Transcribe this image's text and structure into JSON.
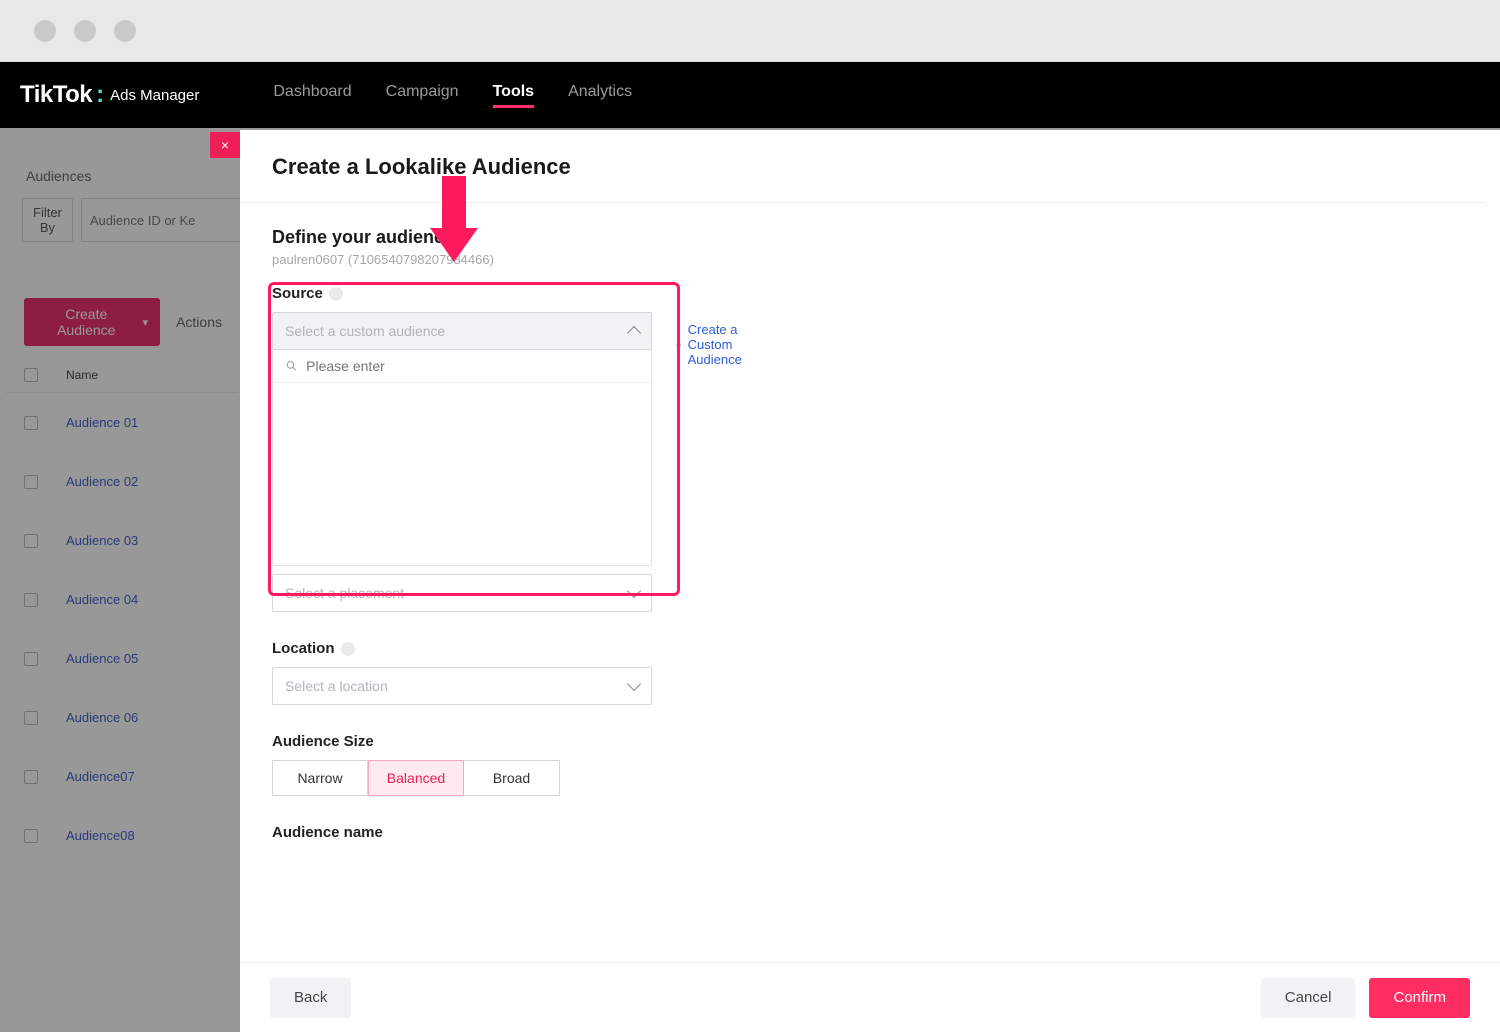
{
  "brand": {
    "name1": "TikTok",
    "name2": "Ads Manager"
  },
  "nav": {
    "items": [
      "Dashboard",
      "Campaign",
      "Tools",
      "Analytics"
    ],
    "active": "Tools"
  },
  "sidebar": {
    "title": "Audiences",
    "filter_label": "Filter By",
    "search_placeholder": "Audience ID or Ke",
    "create_label": "Create Audience",
    "actions_label": "Actions",
    "name_col": "Name",
    "items": [
      "Audience 01",
      "Audience 02",
      "Audience 03",
      "Audience 04",
      "Audience 05",
      "Audience 06",
      "Audience07",
      "Audience08"
    ]
  },
  "panel": {
    "close": "×",
    "title": "Create a Lookalike Audience",
    "define_heading": "Define your audience",
    "user_sub": "paulren0607 (7106540798207934466)",
    "source": {
      "label": "Source",
      "select_placeholder": "Select a custom audience",
      "search_placeholder": "Please enter",
      "create_link": "Create a Custom Audience"
    },
    "placement": {
      "placeholder": "Select a placement"
    },
    "location": {
      "label": "Location",
      "placeholder": "Select a location"
    },
    "size": {
      "label": "Audience Size",
      "options": [
        "Narrow",
        "Balanced",
        "Broad"
      ],
      "selected": "Balanced"
    },
    "name_label": "Audience name",
    "footer": {
      "back": "Back",
      "cancel": "Cancel",
      "confirm": "Confirm"
    }
  }
}
